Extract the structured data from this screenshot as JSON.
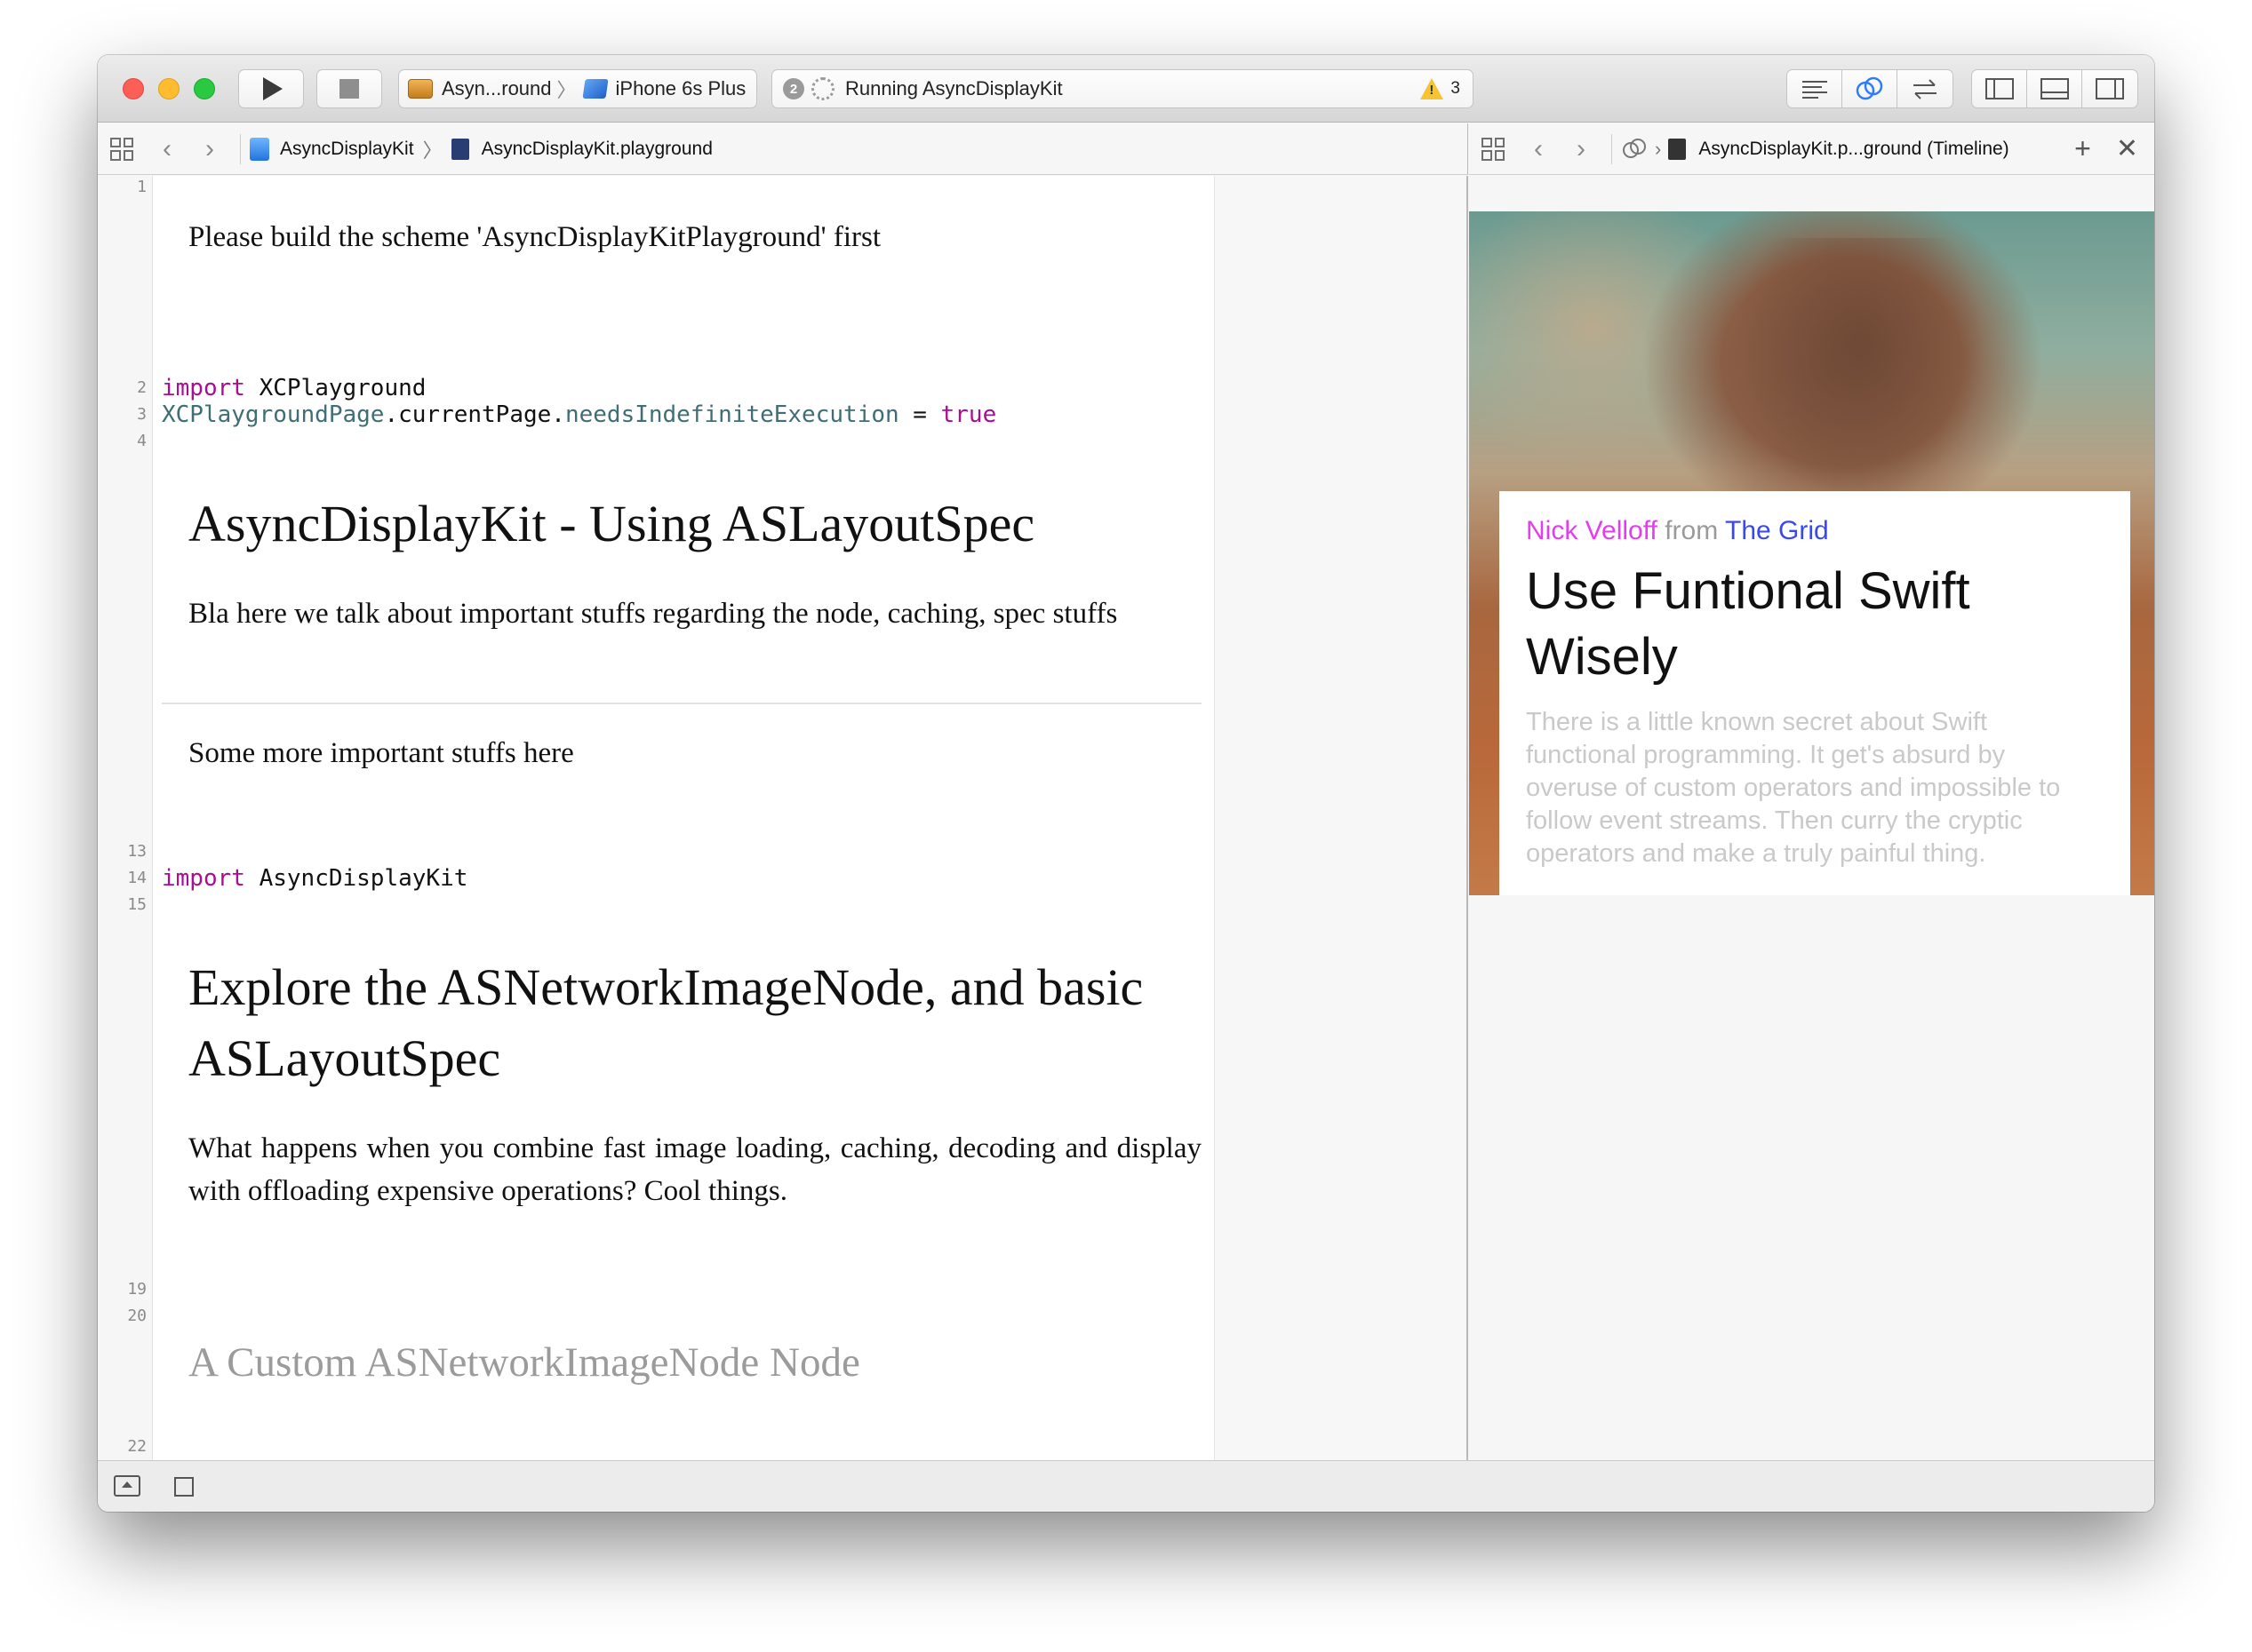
{
  "toolbar": {
    "scheme_name": "Asyn...round",
    "device_name": "iPhone 6s Plus",
    "activity_badge": "2",
    "activity_status": "Running AsyncDisplayKit",
    "warning_count": "3"
  },
  "jumpbar_left": {
    "project": "AsyncDisplayKit",
    "file": "AsyncDisplayKit.playground"
  },
  "jumpbar_right": {
    "file": "AsyncDisplayKit.p...ground (Timeline)"
  },
  "editor": {
    "line_numbers": [
      "1",
      "2",
      "3",
      "4",
      "13",
      "14",
      "15",
      "19",
      "20",
      "22"
    ],
    "intro_text": "Please build the scheme 'AsyncDisplayKitPlayground' first",
    "code_line_2": {
      "keyword": "import",
      "module": "XCPlayground"
    },
    "code_line_3": {
      "type": "XCPlaygroundPage",
      "mid": ".currentPage.",
      "prop": "needsIndefiniteExecution",
      "op": " = ",
      "value": "true"
    },
    "heading_1": "AsyncDisplayKit - Using ASLayoutSpec",
    "paragraph_1": "Bla here we talk about important stuffs regarding the node, caching, spec stuffs",
    "paragraph_2": "Some more important stuffs here",
    "code_line_14": {
      "keyword": "import",
      "module": "AsyncDisplayKit"
    },
    "heading_2": "Explore the ASNetworkImageNode, and basic ASLayoutSpec",
    "paragraph_3": "What happens when you combine fast image loading, caching, decoding and display with offloading expensive operations? Cool things.",
    "heading_3": "A Custom ASNetworkImageNode Node"
  },
  "timeline": {
    "card": {
      "author": "Nick Velloff",
      "from_word": "from",
      "source": "The Grid",
      "title": "Use Funtional Swift Wisely",
      "description": "There is a little known secret about Swift functional programming. It get's absurd by overuse of custom operators and impossible to follow event streams. Then curry the cryptic operators and make a truly painful thing."
    }
  },
  "colors": {
    "keyword": "#aa0d91",
    "type": "#3f6e74",
    "author": "#e63cf1",
    "source": "#3a48f0"
  }
}
